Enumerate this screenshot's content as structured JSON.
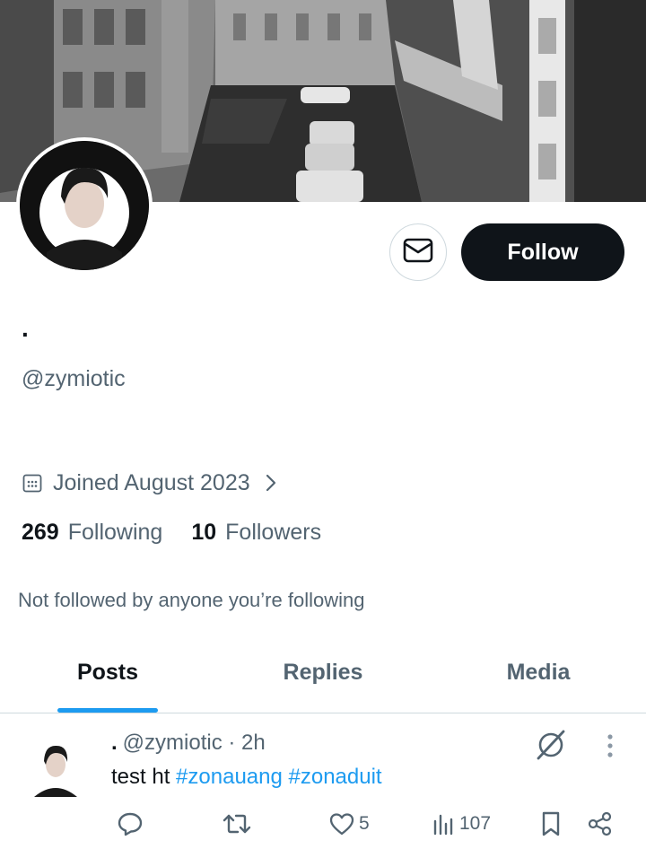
{
  "profile": {
    "display_name": ".",
    "handle": "@zymiotic",
    "joined": "Joined August 2023",
    "following_count": "269",
    "following_label": "Following",
    "followers_count": "10",
    "followers_label": "Followers",
    "not_followed_text": "Not followed by anyone you’re following"
  },
  "actions": {
    "follow_label": "Follow"
  },
  "tabs": [
    {
      "label": "Posts",
      "active": true
    },
    {
      "label": "Replies",
      "active": false
    },
    {
      "label": "Media",
      "active": false
    }
  ],
  "post": {
    "name": ".",
    "meta": "@zymiotic · 2h",
    "text": "test ht ",
    "hashtags": [
      "#zonauang",
      "#zonaduit"
    ],
    "likes": "5",
    "views": "107"
  },
  "icons": [
    "mail-icon",
    "calendar-icon",
    "chevron-right-icon",
    "grok-icon",
    "more-vertical-icon",
    "reply-icon",
    "repost-icon",
    "like-icon",
    "views-icon",
    "bookmark-icon",
    "share-icon"
  ],
  "colors": {
    "accent": "#1d9bf0",
    "text_primary": "#0f1419",
    "text_secondary": "#536471",
    "follow_button_bg": "#0f1419",
    "border": "#cfd9de"
  }
}
